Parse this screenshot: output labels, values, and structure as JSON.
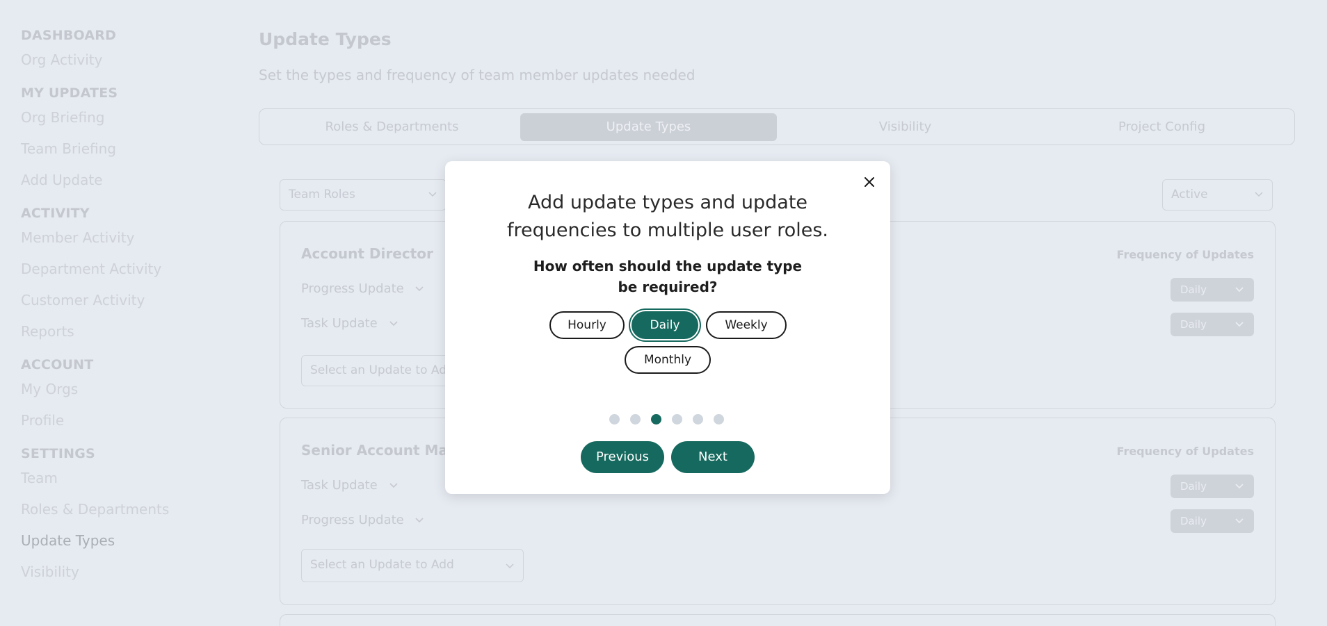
{
  "sidebar": {
    "sections": [
      {
        "title": "DASHBOARD",
        "items": [
          "Org Activity"
        ]
      },
      {
        "title": "MY UPDATES",
        "items": [
          "Org Briefing",
          "Team Briefing",
          "Add Update"
        ]
      },
      {
        "title": "ACTIVITY",
        "items": [
          "Member Activity",
          "Department Activity",
          "Customer Activity",
          "Reports"
        ]
      },
      {
        "title": "ACCOUNT",
        "items": [
          "My Orgs",
          "Profile"
        ]
      },
      {
        "title": "SETTINGS",
        "items": [
          "Team",
          "Roles & Departments",
          "Update Types",
          "Visibility"
        ]
      }
    ]
  },
  "header": {
    "title": "Update Types",
    "subtitle": "Set the types and frequency of team member updates needed"
  },
  "tabs": [
    {
      "label": "Roles & Departments"
    },
    {
      "label": "Update Types"
    },
    {
      "label": "Visibility"
    },
    {
      "label": "Project Config"
    }
  ],
  "filters": {
    "roles_select": "Team Roles",
    "status_select": "Active"
  },
  "cards": [
    {
      "title": "Account Director",
      "freq_label": "Frequency of Updates",
      "updates": [
        {
          "name": "Progress Update",
          "freq": "Daily"
        },
        {
          "name": "Task Update",
          "freq": "Daily"
        }
      ],
      "add_placeholder": "Select an Update to Add"
    },
    {
      "title": "Senior Account Manager",
      "freq_label": "Frequency of Updates",
      "updates": [
        {
          "name": "Task Update",
          "freq": "Daily"
        },
        {
          "name": "Progress Update",
          "freq": "Daily"
        }
      ],
      "add_placeholder": "Select an Update to Add"
    }
  ],
  "modal": {
    "heading": "Add update types and update frequencies to multiple user roles.",
    "question": "How often should the update type be required?",
    "options": [
      "Hourly",
      "Daily",
      "Weekly",
      "Monthly"
    ],
    "selected_option": "Daily",
    "step_current": 3,
    "step_total": 6,
    "previous_label": "Previous",
    "next_label": "Next",
    "accent_color": "#15695e"
  }
}
